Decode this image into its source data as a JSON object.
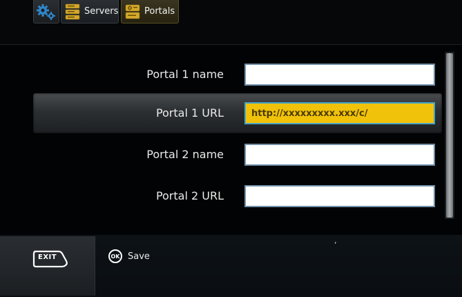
{
  "toolbar": {
    "servers_label": "Servers",
    "portals_label": "Portals",
    "settings_icon": "gear-icon",
    "servers_icon": "server-icon",
    "portals_icon": "portal-settings-icon"
  },
  "form": {
    "rows": [
      {
        "label": "Portal 1 name",
        "value": ""
      },
      {
        "label": "Portal 1 URL",
        "value": "http://xxxxxxxxx.xxx/c/"
      },
      {
        "label": "Portal 2 name",
        "value": ""
      },
      {
        "label": "Portal 2 URL",
        "value": ""
      }
    ]
  },
  "bottom": {
    "exit_label": "EXIT",
    "ok_label": "OK",
    "save_label": "Save",
    "stray_mark": ","
  },
  "colors": {
    "active_input": "#f0c20a",
    "active_input_border": "#48a6c4",
    "icon_blue": "#2f86c9",
    "icon_gold": "#d4a92c"
  }
}
